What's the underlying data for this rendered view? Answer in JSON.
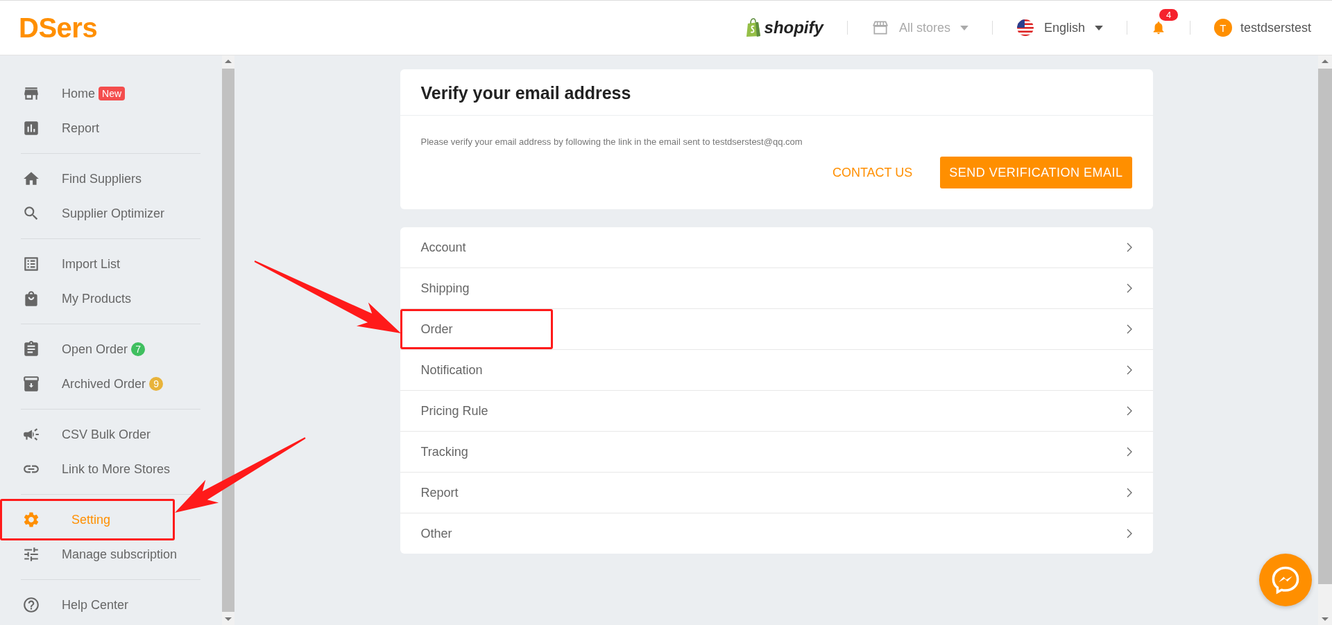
{
  "header": {
    "logo": "DSers",
    "platform": "shopify",
    "store_selector": {
      "label": "All stores",
      "disabled": true
    },
    "language": {
      "label": "English"
    },
    "notifications": {
      "count": "4"
    },
    "user": {
      "avatar_initial": "T",
      "name": "testdserstest"
    }
  },
  "sidebar": {
    "groups": [
      [
        {
          "label": "Home",
          "badge": {
            "text": "New",
            "color": "#f44d4d"
          },
          "selected": false,
          "highlighted": false
        },
        {
          "label": "Report",
          "selected": false,
          "highlighted": false
        }
      ],
      [
        {
          "label": "Find Suppliers",
          "selected": false,
          "highlighted": false
        },
        {
          "label": "Supplier Optimizer",
          "selected": false,
          "highlighted": false
        }
      ],
      [
        {
          "label": "Import List",
          "selected": false,
          "highlighted": false
        },
        {
          "label": "My Products",
          "selected": false,
          "highlighted": false
        }
      ],
      [
        {
          "label": "Open Order",
          "badge": {
            "text": "7",
            "color": "#3fbf5f"
          },
          "selected": false,
          "highlighted": false
        },
        {
          "label": "Archived Order",
          "badge": {
            "text": "9",
            "color": "#e8b33a"
          },
          "selected": false,
          "highlighted": false
        }
      ],
      [
        {
          "label": "CSV Bulk Order",
          "selected": false,
          "highlighted": false
        },
        {
          "label": "Link to More Stores",
          "selected": false,
          "highlighted": false
        }
      ],
      [
        {
          "label": "Setting",
          "selected": true,
          "highlighted": true
        },
        {
          "label": "Manage subscription",
          "selected": false,
          "highlighted": false
        }
      ],
      [
        {
          "label": "Help Center",
          "selected": false,
          "highlighted": false
        }
      ]
    ]
  },
  "verify_card": {
    "title": "Verify your email address",
    "message": "Please verify your email address by following the link in the email sent to testdserstest@qq.com",
    "actions": [
      {
        "label": "CONTACT US",
        "kind": "link"
      },
      {
        "label": "SEND VERIFICATION EMAIL",
        "kind": "primary"
      }
    ]
  },
  "settings_list": {
    "items": [
      {
        "label": "Account",
        "highlighted": false
      },
      {
        "label": "Shipping",
        "highlighted": false
      },
      {
        "label": "Order",
        "highlighted": true
      },
      {
        "label": "Notification",
        "highlighted": false
      },
      {
        "label": "Pricing Rule",
        "highlighted": false
      },
      {
        "label": "Tracking",
        "highlighted": false
      },
      {
        "label": "Report",
        "highlighted": false
      },
      {
        "label": "Other",
        "highlighted": false
      }
    ]
  }
}
